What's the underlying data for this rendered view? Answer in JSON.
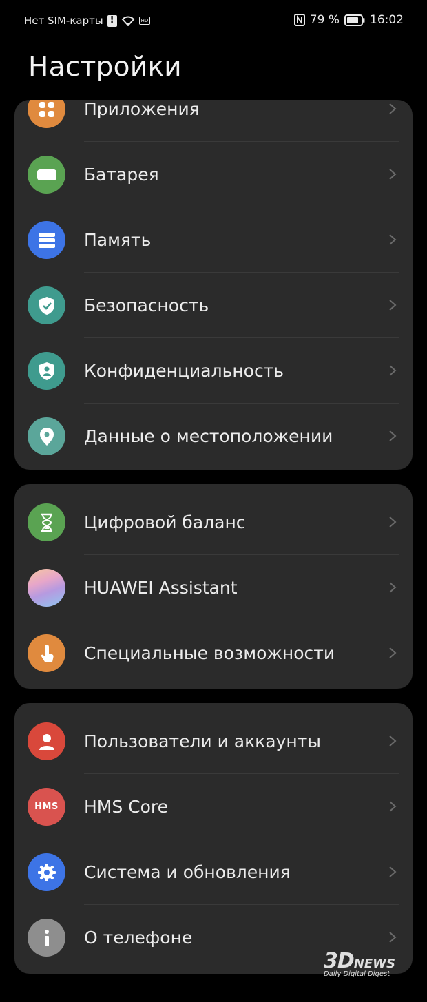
{
  "status_bar": {
    "carrier": "Нет SIM-карты",
    "battery_percent": "79 %",
    "time": "16:02"
  },
  "page_title": "Настройки",
  "groups": [
    {
      "items": [
        {
          "label": "Приложения",
          "icon": "apps-icon",
          "color": "#e08a3e"
        },
        {
          "label": "Батарея",
          "icon": "battery-icon",
          "color": "#5aa352"
        },
        {
          "label": "Память",
          "icon": "storage-icon",
          "color": "#3d74e6"
        },
        {
          "label": "Безопасность",
          "icon": "shield-icon",
          "color": "#3f9b8e"
        },
        {
          "label": "Конфиденциальность",
          "icon": "privacy-icon",
          "color": "#3f9b8e"
        },
        {
          "label": "Данные о местоположении",
          "icon": "location-icon",
          "color": "#5ba69a"
        }
      ]
    },
    {
      "items": [
        {
          "label": "Цифровой баланс",
          "icon": "hourglass-icon",
          "color": "#5aa352"
        },
        {
          "label": "HUAWEI Assistant",
          "icon": "assistant-icon",
          "color": "#c9a7d8"
        },
        {
          "label": "Специальные возможности",
          "icon": "accessibility-icon",
          "color": "#e08a3e"
        }
      ]
    },
    {
      "items": [
        {
          "label": "Пользователи и аккаунты",
          "icon": "user-icon",
          "color": "#d9483b"
        },
        {
          "label": "HMS Core",
          "icon": "hms-icon",
          "color": "#d9534f",
          "icon_text": "HMS"
        },
        {
          "label": "Система и обновления",
          "icon": "gear-icon",
          "color": "#3d74e6"
        },
        {
          "label": "О телефоне",
          "icon": "info-icon",
          "color": "#8e8e8e"
        }
      ]
    }
  ],
  "watermark": {
    "brand": "3D",
    "brand_suffix": "NEWS",
    "tagline": "Daily Digital Digest"
  }
}
